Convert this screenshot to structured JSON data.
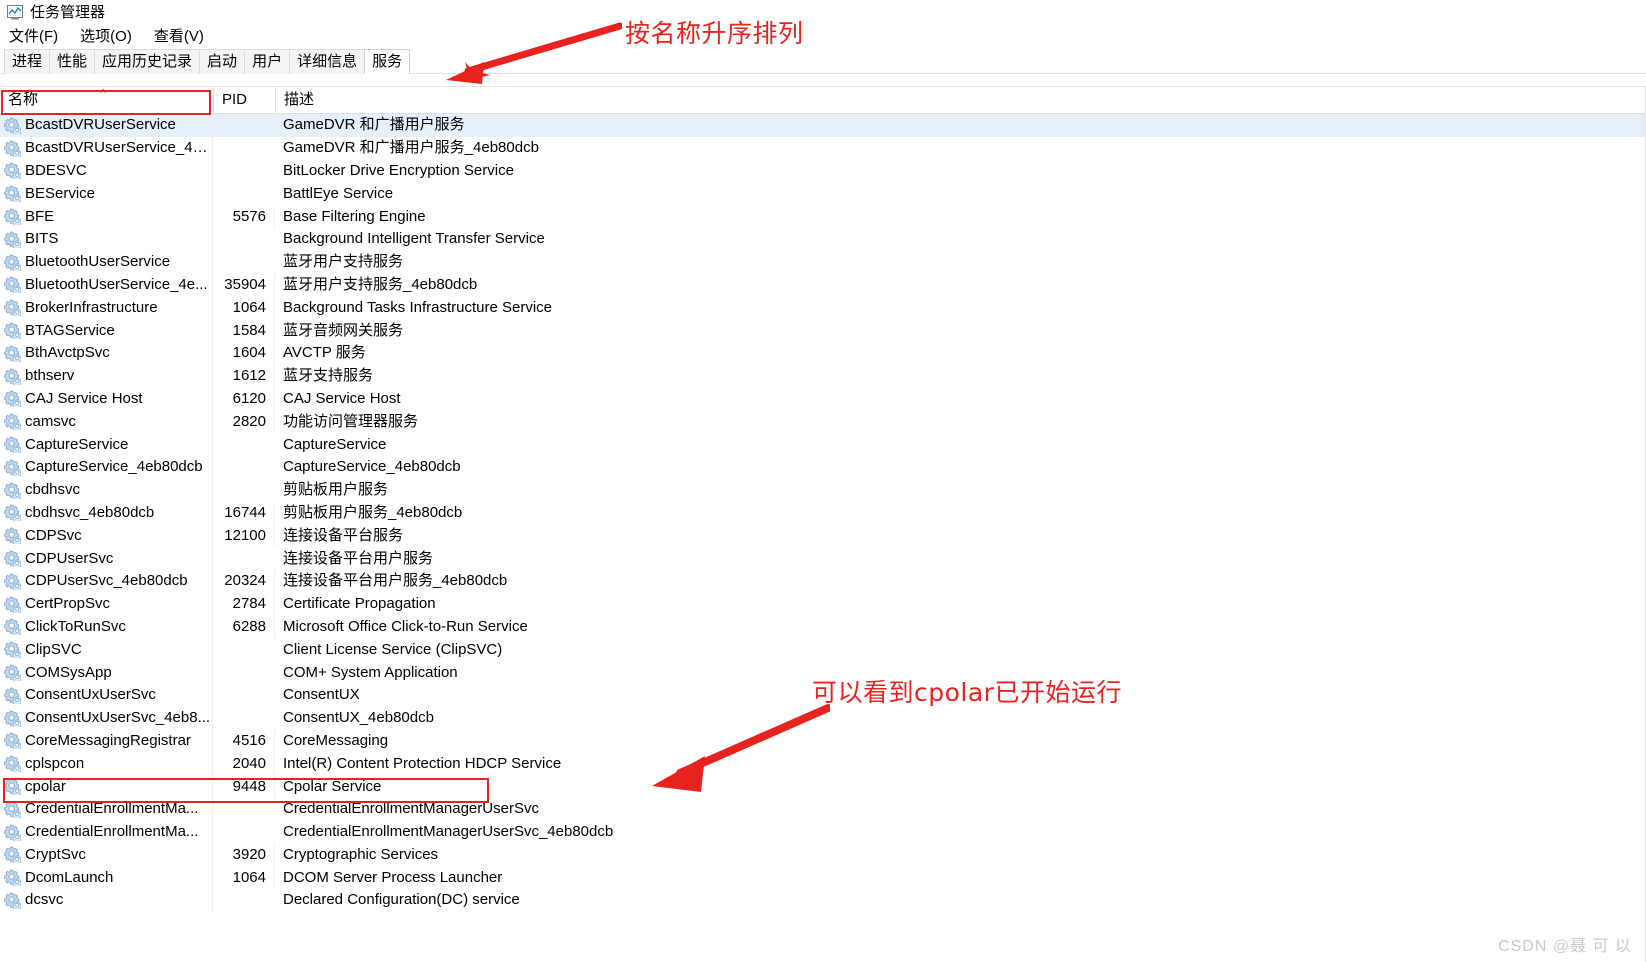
{
  "window": {
    "title": "任务管理器",
    "icon": "task-manager-icon"
  },
  "menu": {
    "items": [
      {
        "label": "文件(F)",
        "name": "menu-file"
      },
      {
        "label": "选项(O)",
        "name": "menu-options"
      },
      {
        "label": "查看(V)",
        "name": "menu-view"
      }
    ]
  },
  "tabs": [
    {
      "label": "进程",
      "active": false
    },
    {
      "label": "性能",
      "active": false
    },
    {
      "label": "应用历史记录",
      "active": false
    },
    {
      "label": "启动",
      "active": false
    },
    {
      "label": "用户",
      "active": false
    },
    {
      "label": "详细信息",
      "active": false
    },
    {
      "label": "服务",
      "active": true
    }
  ],
  "table": {
    "columns": [
      {
        "label": "名称",
        "key": "name",
        "sorted": true,
        "sort_direction": "ascending",
        "sort_glyph": "^"
      },
      {
        "label": "PID",
        "key": "pid"
      },
      {
        "label": "描述",
        "key": "description"
      }
    ],
    "rows": [
      {
        "name": "BcastDVRUserService",
        "pid": "",
        "description": "GameDVR 和广播用户服务",
        "selected": true
      },
      {
        "name": "BcastDVRUserService_4e...",
        "pid": "",
        "description": "GameDVR 和广播用户服务_4eb80dcb",
        "selected": false
      },
      {
        "name": "BDESVC",
        "pid": "",
        "description": "BitLocker Drive Encryption Service",
        "selected": false
      },
      {
        "name": "BEService",
        "pid": "",
        "description": "BattlEye Service",
        "selected": false
      },
      {
        "name": "BFE",
        "pid": "5576",
        "description": "Base Filtering Engine",
        "selected": false
      },
      {
        "name": "BITS",
        "pid": "",
        "description": "Background Intelligent Transfer Service",
        "selected": false
      },
      {
        "name": "BluetoothUserService",
        "pid": "",
        "description": "蓝牙用户支持服务",
        "selected": false
      },
      {
        "name": "BluetoothUserService_4e...",
        "pid": "35904",
        "description": "蓝牙用户支持服务_4eb80dcb",
        "selected": false
      },
      {
        "name": "BrokerInfrastructure",
        "pid": "1064",
        "description": "Background Tasks Infrastructure Service",
        "selected": false
      },
      {
        "name": "BTAGService",
        "pid": "1584",
        "description": "蓝牙音频网关服务",
        "selected": false
      },
      {
        "name": "BthAvctpSvc",
        "pid": "1604",
        "description": "AVCTP 服务",
        "selected": false
      },
      {
        "name": "bthserv",
        "pid": "1612",
        "description": "蓝牙支持服务",
        "selected": false
      },
      {
        "name": "CAJ Service Host",
        "pid": "6120",
        "description": "CAJ Service Host",
        "selected": false
      },
      {
        "name": "camsvc",
        "pid": "2820",
        "description": "功能访问管理器服务",
        "selected": false
      },
      {
        "name": "CaptureService",
        "pid": "",
        "description": "CaptureService",
        "selected": false
      },
      {
        "name": "CaptureService_4eb80dcb",
        "pid": "",
        "description": "CaptureService_4eb80dcb",
        "selected": false
      },
      {
        "name": "cbdhsvc",
        "pid": "",
        "description": "剪贴板用户服务",
        "selected": false
      },
      {
        "name": "cbdhsvc_4eb80dcb",
        "pid": "16744",
        "description": "剪贴板用户服务_4eb80dcb",
        "selected": false
      },
      {
        "name": "CDPSvc",
        "pid": "12100",
        "description": "连接设备平台服务",
        "selected": false
      },
      {
        "name": "CDPUserSvc",
        "pid": "",
        "description": "连接设备平台用户服务",
        "selected": false
      },
      {
        "name": "CDPUserSvc_4eb80dcb",
        "pid": "20324",
        "description": "连接设备平台用户服务_4eb80dcb",
        "selected": false
      },
      {
        "name": "CertPropSvc",
        "pid": "2784",
        "description": "Certificate Propagation",
        "selected": false
      },
      {
        "name": "ClickToRunSvc",
        "pid": "6288",
        "description": "Microsoft Office Click-to-Run Service",
        "selected": false
      },
      {
        "name": "ClipSVC",
        "pid": "",
        "description": "Client License Service (ClipSVC)",
        "selected": false
      },
      {
        "name": "COMSysApp",
        "pid": "",
        "description": "COM+ System Application",
        "selected": false
      },
      {
        "name": "ConsentUxUserSvc",
        "pid": "",
        "description": "ConsentUX",
        "selected": false
      },
      {
        "name": "ConsentUxUserSvc_4eb8...",
        "pid": "",
        "description": "ConsentUX_4eb80dcb",
        "selected": false
      },
      {
        "name": "CoreMessagingRegistrar",
        "pid": "4516",
        "description": "CoreMessaging",
        "selected": false
      },
      {
        "name": "cplspcon",
        "pid": "2040",
        "description": "Intel(R) Content Protection HDCP Service",
        "selected": false
      },
      {
        "name": "cpolar",
        "pid": "9448",
        "description": "Cpolar Service",
        "selected": false
      },
      {
        "name": "CredentialEnrollmentMa...",
        "pid": "",
        "description": "CredentialEnrollmentManagerUserSvc",
        "selected": false
      },
      {
        "name": "CredentialEnrollmentMa...",
        "pid": "",
        "description": "CredentialEnrollmentManagerUserSvc_4eb80dcb",
        "selected": false
      },
      {
        "name": "CryptSvc",
        "pid": "3920",
        "description": "Cryptographic Services",
        "selected": false
      },
      {
        "name": "DcomLaunch",
        "pid": "1064",
        "description": "DCOM Server Process Launcher",
        "selected": false
      },
      {
        "name": "dcsvc",
        "pid": "",
        "description": "Declared Configuration(DC) service",
        "selected": false
      }
    ]
  },
  "annotations": [
    {
      "id": "sort",
      "text": "按名称升序排列",
      "color": "#e8231f",
      "icon": "arrow-left-icon"
    },
    {
      "id": "cpolar",
      "text": "可以看到cpolar已开始运行",
      "color": "#e8231f",
      "icon": "arrow-left-icon"
    }
  ],
  "watermark": {
    "text": "CSDN @聂 可 以"
  },
  "colors": {
    "annotation_red": "#e8231f",
    "selection_blue": "#e5f0fb",
    "service_icon": "#b9d5ef"
  }
}
